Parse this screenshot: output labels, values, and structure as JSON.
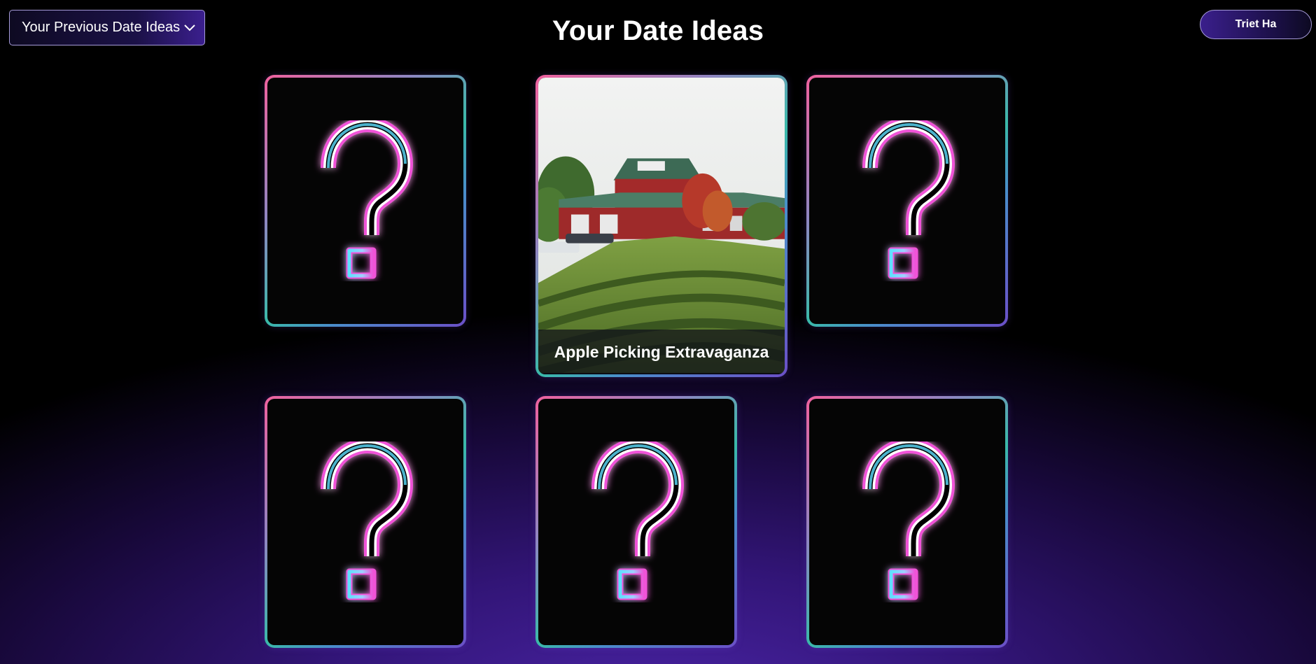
{
  "header": {
    "previous_ideas_label": "Your Previous Date Ideas",
    "title": "Your Date Ideas",
    "user_name": "Triet Ha"
  },
  "cards": [
    {
      "state": "hidden",
      "icon": "question-mark-icon"
    },
    {
      "state": "revealed",
      "caption": "Apple Picking Extravaganza",
      "image": "barn-orchard-photo"
    },
    {
      "state": "hidden",
      "icon": "question-mark-icon"
    },
    {
      "state": "hidden",
      "icon": "question-mark-icon"
    },
    {
      "state": "hidden",
      "icon": "question-mark-icon"
    },
    {
      "state": "hidden",
      "icon": "question-mark-icon"
    }
  ],
  "colors": {
    "accent_purple": "#3b1f8e",
    "neon_pink": "#f052d8",
    "neon_cyan": "#5fe0ff",
    "card_border_pink": "#f0619e",
    "card_border_teal": "#3ab9a9"
  }
}
